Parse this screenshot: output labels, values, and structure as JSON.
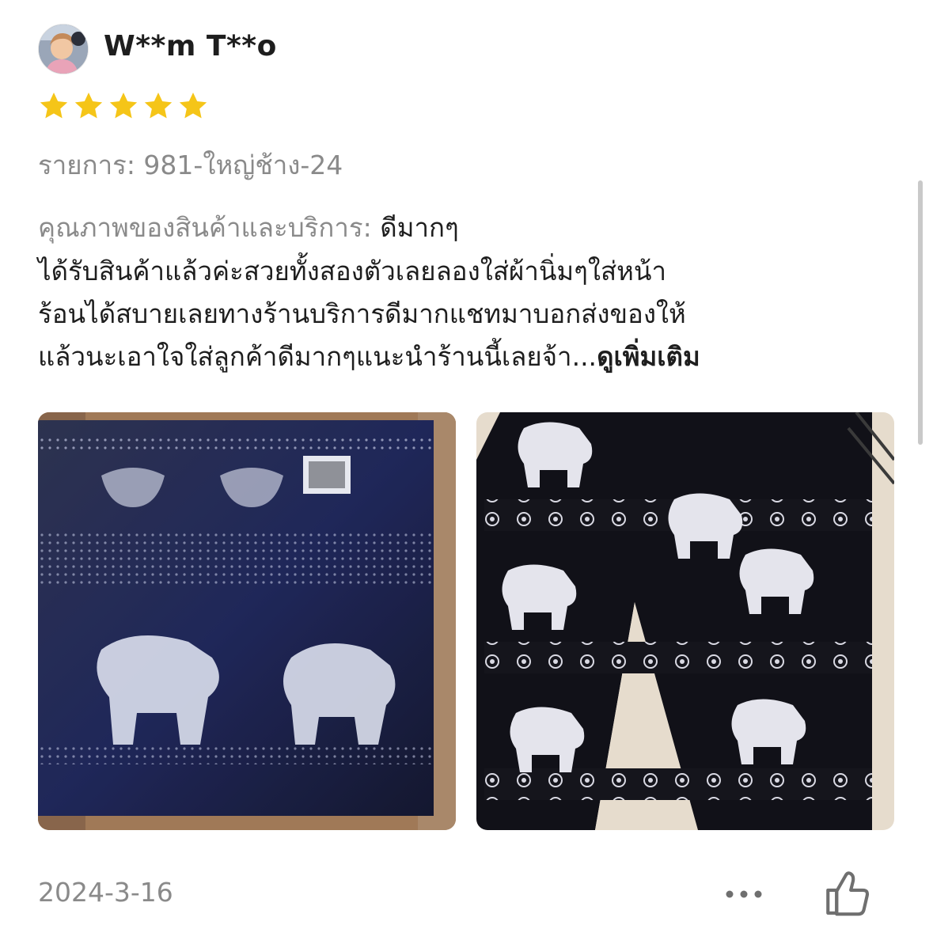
{
  "review": {
    "username": "W**m T**o",
    "rating": 5,
    "variant": "รายการ: 981-ใหญ่ช้าง-24",
    "quality_label": "คุณภาพของสินค้าและบริการ:",
    "quality_value": "ดีมากๆ",
    "body_lines": [
      "ได้รับสินค้าแล้วค่ะสวยทั้งสองตัวเลยลองใส่ผ้านิ่มๆใส่หน้า",
      "ร้อนได้สบายเลยทางร้านบริการดีมากแชทมาบอกส่งของให้",
      "แล้วนะเอาใจใส่ลูกค้าดีมากๆแนะนำร้านนี้เลยจ้า..."
    ],
    "see_more": "ดูเพิ่มเติม",
    "date": "2024-3-16",
    "more_icon": "ellipsis-icon",
    "like_icon": "thumbs-up-icon"
  },
  "colors": {
    "star": "#F5C518",
    "muted_text": "#8A8A8A",
    "primary_text": "#1E1E1E"
  }
}
